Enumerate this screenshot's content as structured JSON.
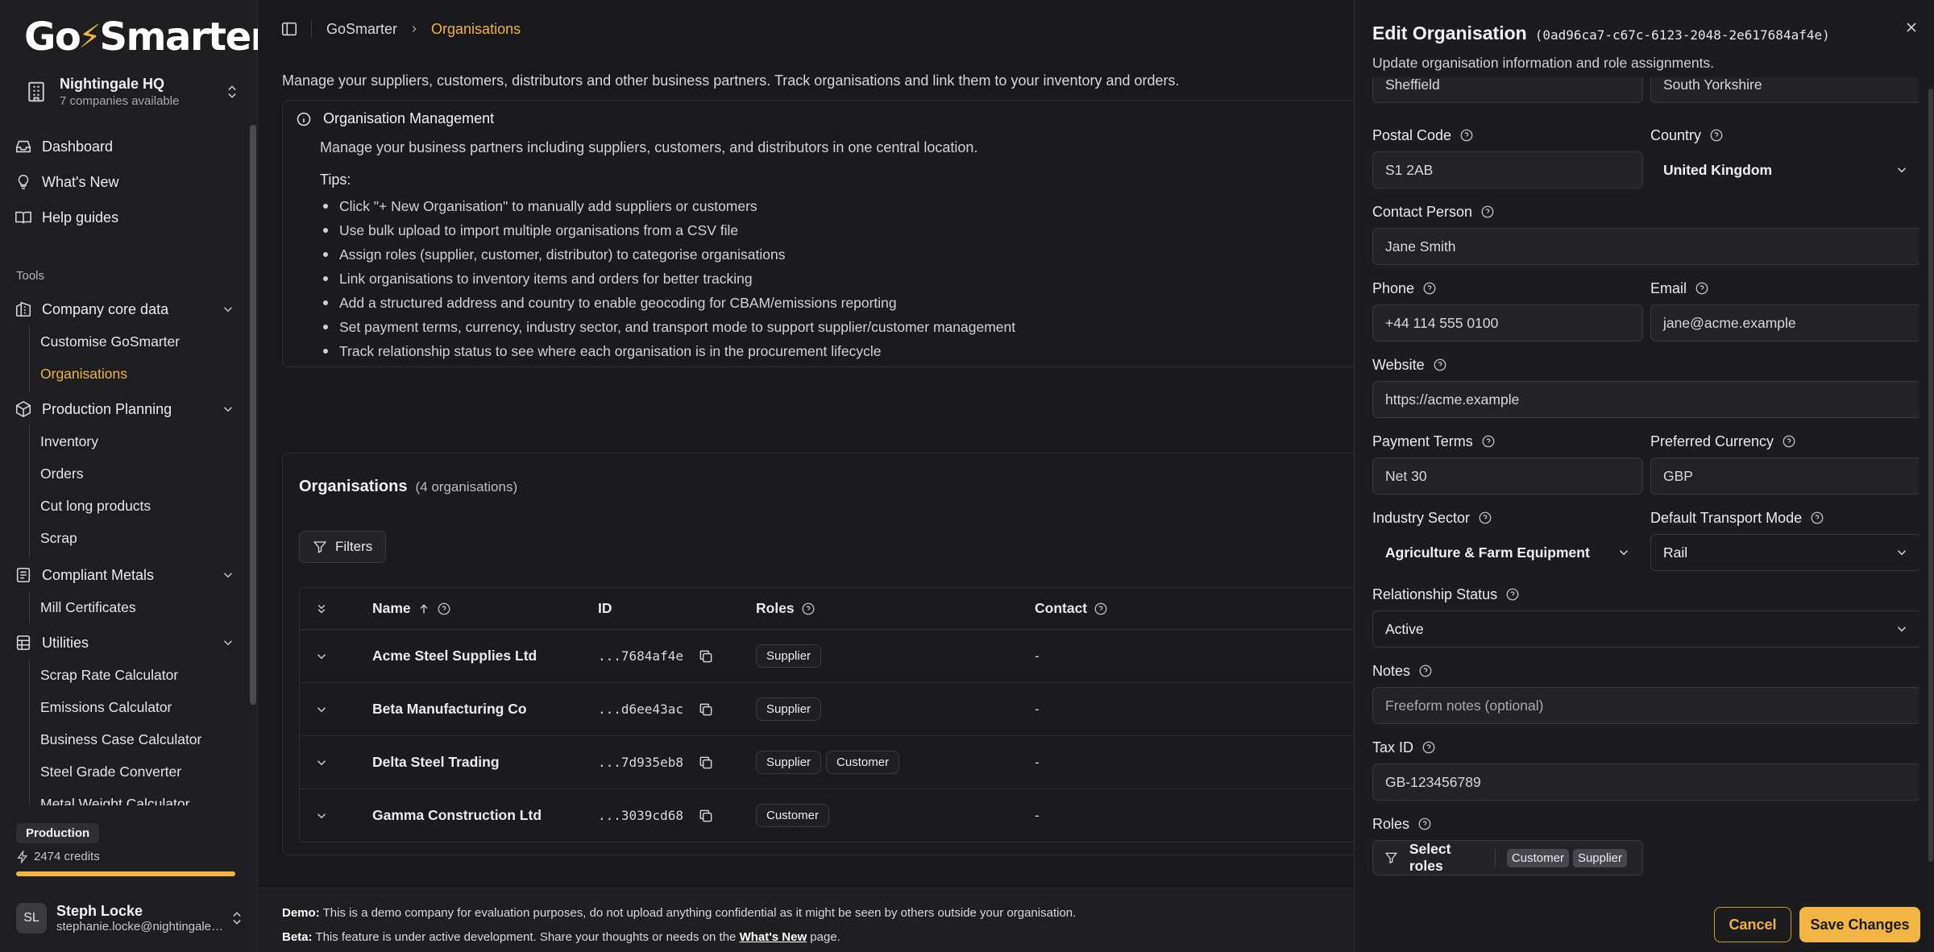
{
  "brand": {
    "logo_pre": "Go",
    "logo_post": "Smarter",
    "accent": "#f2b544"
  },
  "company": {
    "name": "Nightingale HQ",
    "subtitle": "7 companies available"
  },
  "nav": {
    "dashboard": "Dashboard",
    "whats_new": "What's New",
    "help": "Help guides",
    "tools_label": "Tools",
    "core": "Company core data",
    "customise": "Customise GoSmarter",
    "organisations": "Organisations",
    "planning": "Production Planning",
    "inventory": "Inventory",
    "orders": "Orders",
    "cut": "Cut long products",
    "scrap": "Scrap",
    "compliant": "Compliant Metals",
    "mill": "Mill Certificates",
    "utilities": "Utilities",
    "scrap_rate": "Scrap Rate Calculator",
    "emissions": "Emissions Calculator",
    "business": "Business Case Calculator",
    "grade": "Steel Grade Converter",
    "weight": "Metal Weight Calculator"
  },
  "plan": {
    "badge": "Production",
    "credits": "2474 credits",
    "usage_fraction": 1.0
  },
  "user": {
    "initials": "SL",
    "name": "Steph Locke",
    "email": "stephanie.locke@nightingalehq.ai"
  },
  "breadcrumb": {
    "root": "GoSmarter",
    "current": "Organisations"
  },
  "intro": "Manage your suppliers, customers, distributors and other business partners. Track organisations and link them to your inventory and orders.",
  "info": {
    "title": "Organisation Management",
    "desc": "Manage your business partners including suppliers, customers, and distributors in one central location.",
    "tips_label": "Tips:",
    "tips": [
      "Click \"+ New Organisation\" to manually add suppliers or customers",
      "Use bulk upload to import multiple organisations from a CSV file",
      "Assign roles (supplier, customer, distributor) to categorise organisations",
      "Link organisations to inventory items and orders for better tracking",
      "Add a structured address and country to enable geocoding for CBAM/emissions reporting",
      "Set payment terms, currency, industry sector, and transport mode to support supplier/customer management",
      "Track relationship status to see where each organisation is in the procurement lifecycle"
    ]
  },
  "orgs": {
    "title": "Organisations",
    "count": "(4 organisations)",
    "filters": "Filters",
    "columns": {
      "name": "Name",
      "id": "ID",
      "roles": "Roles",
      "contact": "Contact"
    },
    "rows": [
      {
        "name": "Acme Steel Supplies Ltd",
        "id": "...7684af4e",
        "roles": [
          "Supplier"
        ],
        "contact": "-"
      },
      {
        "name": "Beta Manufacturing Co",
        "id": "...d6ee43ac",
        "roles": [
          "Supplier"
        ],
        "contact": "-"
      },
      {
        "name": "Delta Steel Trading",
        "id": "...7d935eb8",
        "roles": [
          "Supplier",
          "Customer"
        ],
        "contact": "-"
      },
      {
        "name": "Gamma Construction Ltd",
        "id": "...3039cd68",
        "roles": [
          "Customer"
        ],
        "contact": "-"
      }
    ]
  },
  "footer": {
    "demo_label": "Demo:",
    "demo_text": " This is a demo company for evaluation purposes, do not upload anything confidential as it might be seen by others outside your organisation.",
    "beta_label": "Beta:",
    "beta_text": " This feature is under active development. Share your thoughts or needs on the ",
    "beta_link": "What's New",
    "beta_end": " page."
  },
  "drawer": {
    "title": "Edit Organisation",
    "id": "(0ad96ca7-c67c-6123-2048-2e617684af4e)",
    "subtitle": "Update organisation information and role assignments.",
    "city": "Sheffield",
    "region": "South Yorkshire",
    "postal_label": "Postal Code",
    "postal": "S1 2AB",
    "country_label": "Country",
    "country": "United Kingdom",
    "contact_label": "Contact Person",
    "contact": "Jane Smith",
    "phone_label": "Phone",
    "phone": "+44 114 555 0100",
    "email_label": "Email",
    "email": "jane@acme.example",
    "website_label": "Website",
    "website": "https://acme.example",
    "terms_label": "Payment Terms",
    "terms": "Net 30",
    "currency_label": "Preferred Currency",
    "currency": "GBP",
    "industry_label": "Industry Sector",
    "industry": "Agriculture & Farm Equipment",
    "transport_label": "Default Transport Mode",
    "transport": "Rail",
    "status_label": "Relationship Status",
    "status": "Active",
    "notes_label": "Notes",
    "notes_placeholder": "Freeform notes (optional)",
    "tax_label": "Tax ID",
    "tax": "GB-123456789",
    "roles_label": "Roles",
    "roles_select": "Select roles",
    "roles": [
      "Customer",
      "Supplier"
    ],
    "cancel": "Cancel",
    "save": "Save Changes"
  }
}
